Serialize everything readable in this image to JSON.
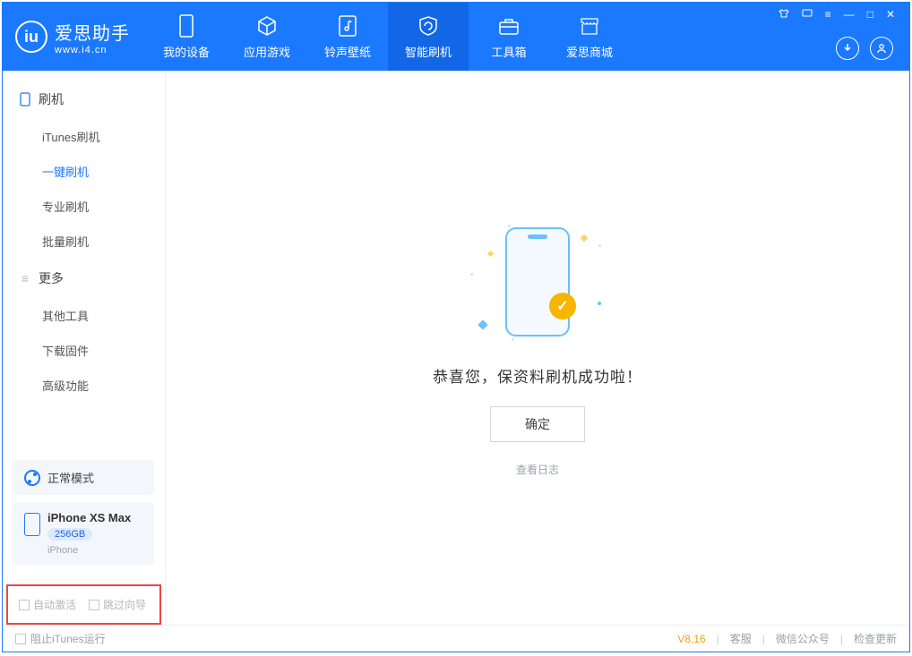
{
  "app": {
    "name": "爱思助手",
    "site": "www.i4.cn"
  },
  "nav": {
    "items": [
      {
        "id": "device",
        "label": "我的设备"
      },
      {
        "id": "apps",
        "label": "应用游戏"
      },
      {
        "id": "ring",
        "label": "铃声壁纸"
      },
      {
        "id": "flash",
        "label": "智能刷机",
        "active": true
      },
      {
        "id": "tools",
        "label": "工具箱"
      },
      {
        "id": "store",
        "label": "爱思商城"
      }
    ]
  },
  "sidebar": {
    "groups": [
      {
        "title": "刷机",
        "items": [
          {
            "label": "iTunes刷机"
          },
          {
            "label": "一键刷机",
            "active": true
          },
          {
            "label": "专业刷机"
          },
          {
            "label": "批量刷机"
          }
        ]
      },
      {
        "title": "更多",
        "items": [
          {
            "label": "其他工具"
          },
          {
            "label": "下载固件"
          },
          {
            "label": "高级功能"
          }
        ]
      }
    ]
  },
  "device": {
    "mode": "正常模式",
    "name": "iPhone XS Max",
    "capacity": "256GB",
    "type": "iPhone"
  },
  "options": {
    "auto_activate": "自动激活",
    "skip_guide": "跳过向导"
  },
  "main": {
    "message": "恭喜您，保资料刷机成功啦！",
    "ok": "确定",
    "log": "查看日志"
  },
  "status": {
    "block_itunes": "阻止iTunes运行",
    "version": "V8.16",
    "links": [
      "客服",
      "微信公众号",
      "检查更新"
    ]
  }
}
